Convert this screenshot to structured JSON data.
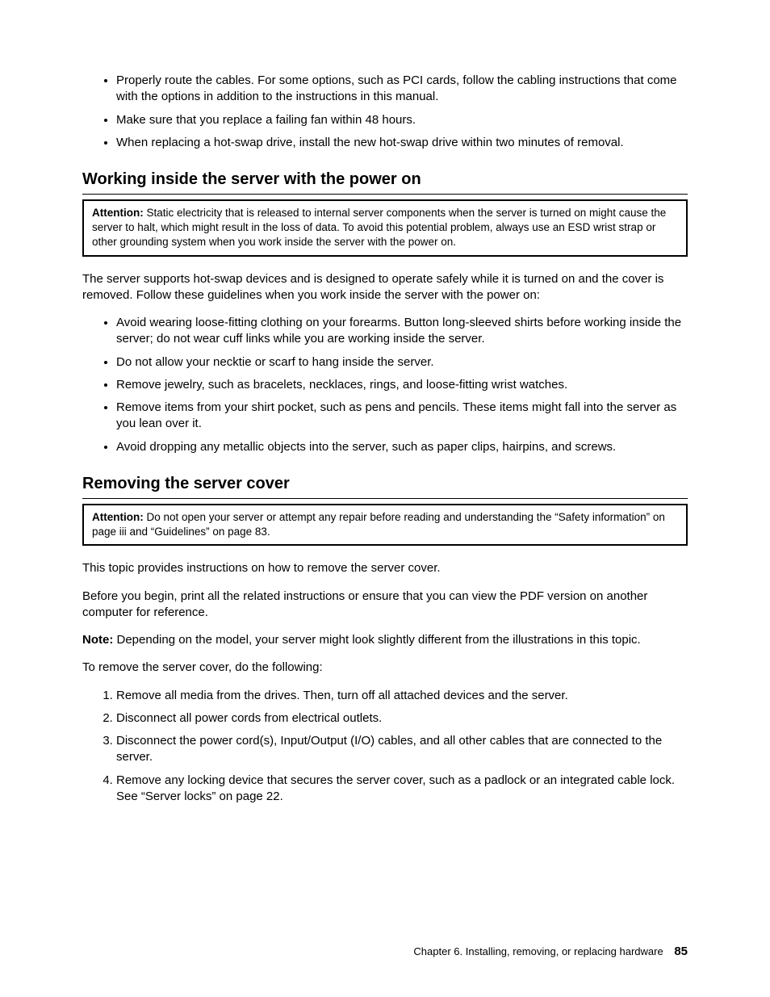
{
  "top_bullets": [
    "Properly route the cables. For some options, such as PCI cards, follow the cabling instructions that come with the options in addition to the instructions in this manual.",
    "Make sure that you replace a failing fan within 48 hours.",
    "When replacing a hot-swap drive, install the new hot-swap drive within two minutes of removal."
  ],
  "section1": {
    "heading": "Working inside the server with the power on",
    "attention_label": "Attention:",
    "attention_text": " Static electricity that is released to internal server components when the server is turned on might cause the server to halt, which might result in the loss of data. To avoid this potential problem, always use an ESD wrist strap or other grounding system when you work inside the server with the power on.",
    "intro": "The server supports hot-swap devices and is designed to operate safely while it is turned on and the cover is removed. Follow these guidelines when you work inside the server with the power on:",
    "bullets": [
      "Avoid wearing loose-fitting clothing on your forearms. Button long-sleeved shirts before working inside the server; do not wear cuff links while you are working inside the server.",
      "Do not allow your necktie or scarf to hang inside the server.",
      "Remove jewelry, such as bracelets, necklaces, rings, and loose-fitting wrist watches.",
      "Remove items from your shirt pocket, such as pens and pencils. These items might fall into the server as you lean over it.",
      "Avoid dropping any metallic objects into the server, such as paper clips, hairpins, and screws."
    ]
  },
  "section2": {
    "heading": "Removing the server cover",
    "attention_label": "Attention:",
    "attention_text": " Do not open your server or attempt any repair before reading and understanding the “Safety information” on page iii and “Guidelines” on page 83.",
    "para1": "This topic provides instructions on how to remove the server cover.",
    "para2": "Before you begin, print all the related instructions or ensure that you can view the PDF version on another computer for reference.",
    "note_label": "Note:",
    "note_text": " Depending on the model, your server might look slightly different from the illustrations in this topic.",
    "para3": "To remove the server cover, do the following:",
    "steps": [
      "Remove all media from the drives. Then, turn off all attached devices and the server.",
      "Disconnect all power cords from electrical outlets.",
      "Disconnect the power cord(s), Input/Output (I/O) cables, and all other cables that are connected to the server.",
      "Remove any locking device that secures the server cover, such as a padlock or an integrated cable lock. See “Server locks” on page 22."
    ]
  },
  "footer": {
    "chapter": "Chapter 6. Installing, removing, or replacing hardware",
    "page": "85"
  }
}
